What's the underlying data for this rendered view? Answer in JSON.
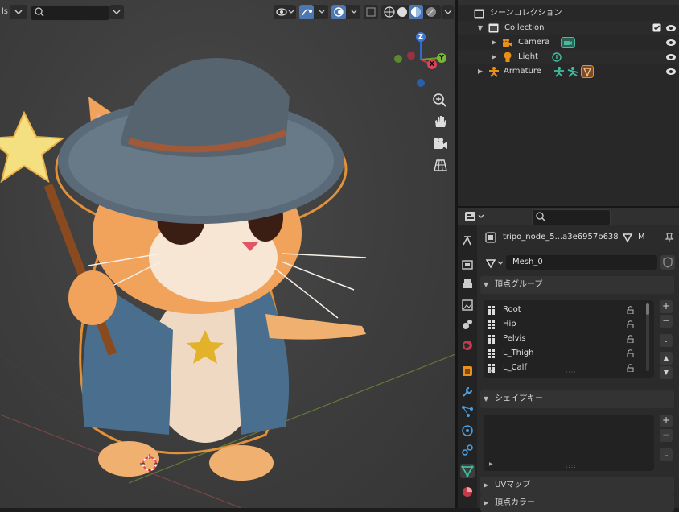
{
  "viewport": {
    "search_placeholder": "",
    "left_label": "ls",
    "gizmo": {
      "z": "Z",
      "y": "Y",
      "x": "X"
    }
  },
  "outliner": {
    "scene_collection": "シーンコレクション",
    "items": [
      {
        "label": "Collection"
      },
      {
        "label": "Camera"
      },
      {
        "label": "Light"
      },
      {
        "label": "Armature"
      }
    ]
  },
  "properties": {
    "search_placeholder": "",
    "object_name": "tripo_node_5...a3e6957b638",
    "mesh_tag": "M",
    "mesh_name": "Mesh_0",
    "vertex_groups_title": "頂点グループ",
    "vertex_groups": [
      "Root",
      "Hip",
      "Pelvis",
      "L_Thigh",
      "L_Calf"
    ],
    "shape_keys_title": "シェイプキー",
    "uv_maps_title": "UVマップ",
    "vertex_colors_title": "頂点カラー",
    "colors": {
      "accent": "#4c9ddd",
      "armature": "#e8901a",
      "mesh": "#3fbf9f"
    }
  }
}
